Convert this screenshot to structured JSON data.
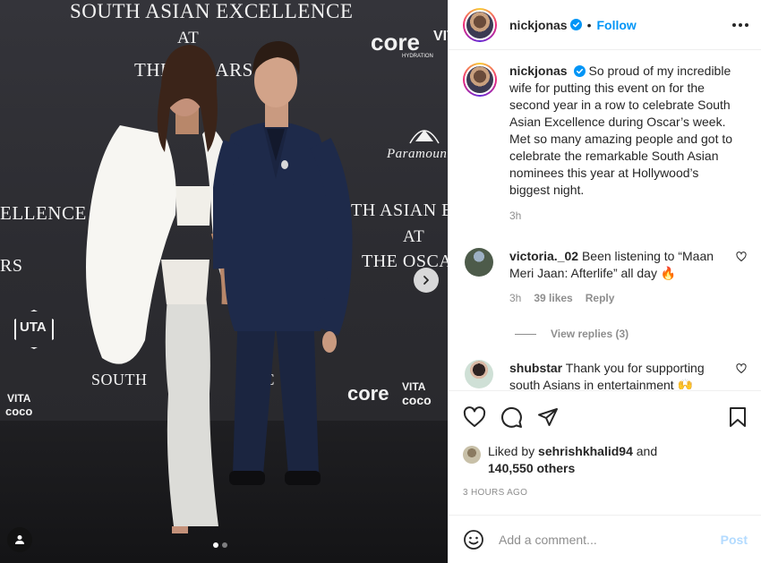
{
  "photo": {
    "backdrop_text": {
      "top_title": "SOUTH ASIAN EXCELLENCE",
      "top_at": "AT",
      "top_oscars": "THE OSCARS",
      "left_excellence": "ELLENCE",
      "left_rs": "RS",
      "right_title": "TH ASIAN EXCE",
      "right_at": "AT",
      "right_oscars": "THE OSCAR",
      "core_top": "core",
      "vita_top": "VITA",
      "core_hydration": "HYDRATION",
      "paramount": "Paramount",
      "uta": "UTA",
      "core_bottom": "core",
      "vita_bottom": "VITA",
      "coco_bottom": "coco",
      "vita_left": "VITA",
      "coco_left": "coco",
      "south_bottom": "SOUTH",
      "rc_bottom": "RC"
    },
    "carousel": {
      "current": 1,
      "total": 2
    }
  },
  "header": {
    "username": "nickjonas",
    "separator": "•",
    "follow_label": "Follow"
  },
  "caption": {
    "username": "nickjonas",
    "text": "So proud of my incredible wife for putting this event on for the second year in a row to celebrate South Asian Excellence during Oscar’s week. Met so many amazing people and got to celebrate the remarkable South Asian nominees this year at Hollywood’s biggest night.",
    "time": "3h"
  },
  "comments": [
    {
      "username": "victoria._02",
      "text": "Been listening to “Maan Meri Jaan: Afterlife” all day 🔥",
      "time": "3h",
      "likes": "39 likes",
      "reply_label": "Reply",
      "view_replies": "View replies (3)"
    },
    {
      "username": "shubstar",
      "text": "Thank you for supporting south Asians in entertainment 🙌"
    }
  ],
  "likes": {
    "prefix": "Liked by",
    "user": "sehrishkhalid94",
    "connector": "and",
    "others": "140,550 others"
  },
  "post_time": "3 HOURS AGO",
  "add_comment": {
    "placeholder": "Add a comment...",
    "post_label": "Post"
  },
  "colors": {
    "accent": "#0095f6",
    "post_disabled": "#b3dbff",
    "muted": "#8e8e8e",
    "text": "#262626"
  }
}
